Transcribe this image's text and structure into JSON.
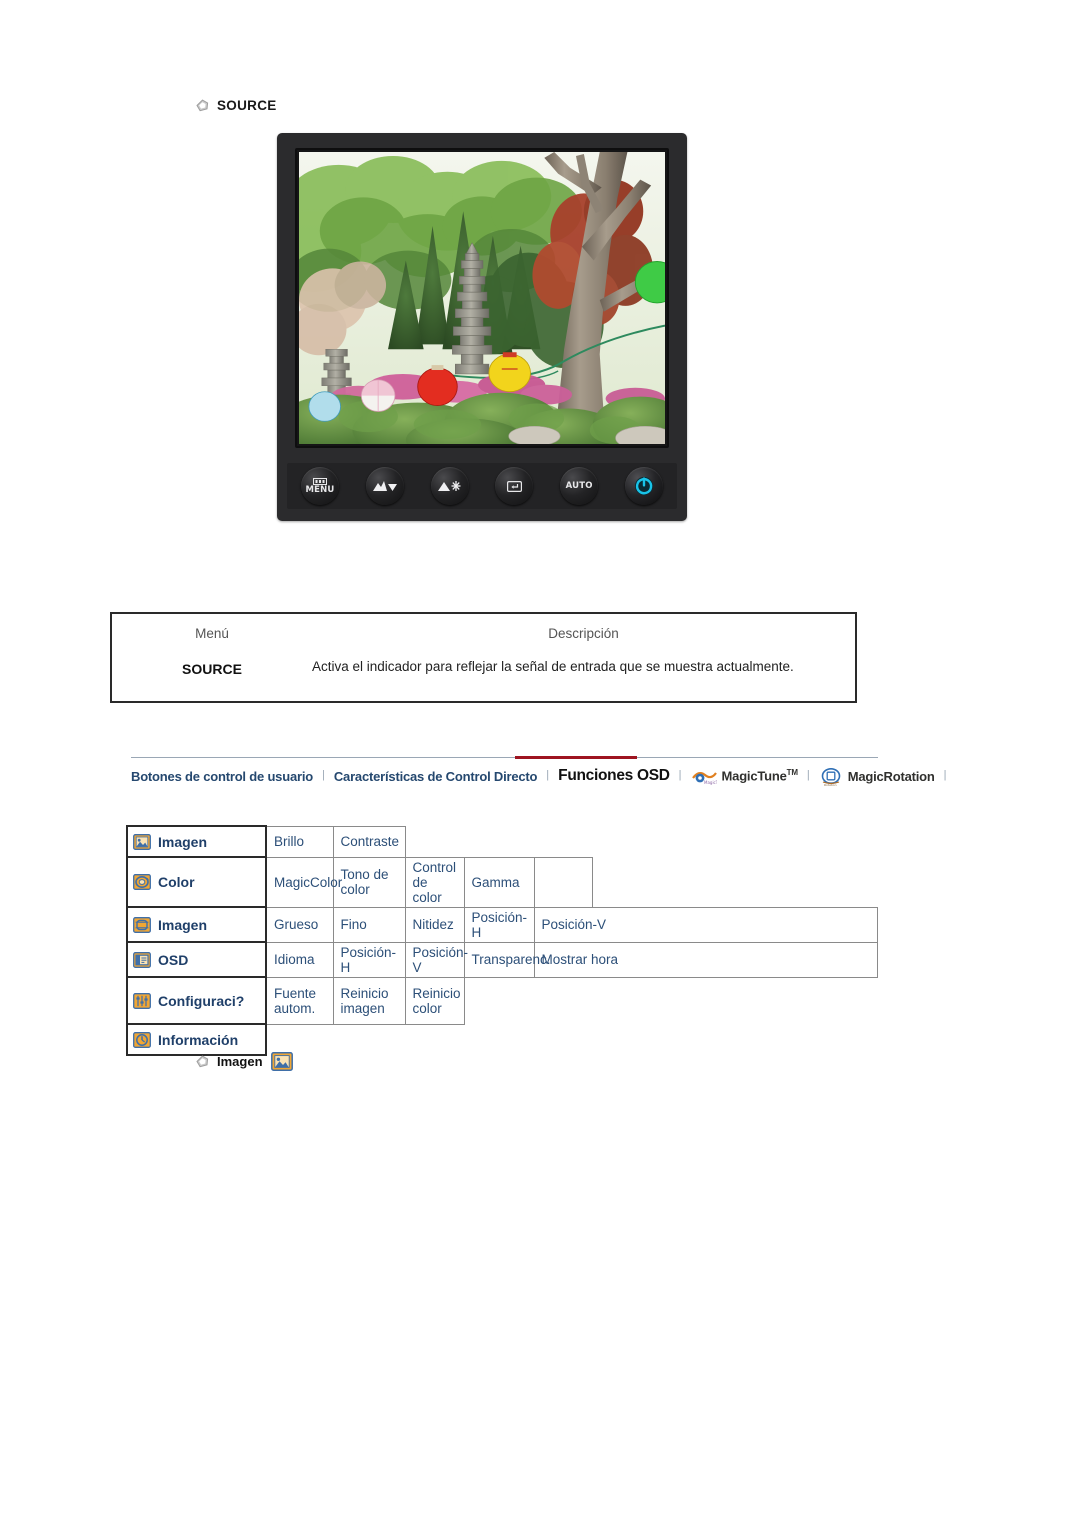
{
  "source_section": {
    "bullet_icon": "pentagon-bullet-icon",
    "heading": "SOURCE"
  },
  "monitor": {
    "screen_photo_alt": "korean-temple-garden-with-stone-pagoda-and-paper-lanterns",
    "buttons": [
      {
        "name": "menu-button",
        "icon": "menu-bars-icon",
        "label": "MENU"
      },
      {
        "name": "down-brightness-button",
        "icon": "brightness-down-arrow-icon",
        "label": ""
      },
      {
        "name": "up-brightness-button",
        "icon": "brightness-up-arrow-icon",
        "label": ""
      },
      {
        "name": "enter-button",
        "icon": "enter-rectangle-icon",
        "label": ""
      },
      {
        "name": "auto-button",
        "icon": "auto-text-icon",
        "label": "AUTO"
      },
      {
        "name": "power-button",
        "icon": "power-symbol-icon",
        "label": ""
      }
    ],
    "power_led_color": "#19c3e8"
  },
  "description_table": {
    "headers": {
      "menu": "Menú",
      "description": "Descripción"
    },
    "rows": [
      {
        "menu": "SOURCE",
        "description": "Activa el indicador para reflejar la señal de entrada que se muestra actualmente."
      }
    ]
  },
  "navbar": {
    "active_underline_color": "#9e1420",
    "separator": "|",
    "items": [
      {
        "label": "Botones de control de usuario",
        "active": false,
        "icon": null
      },
      {
        "label": "Características de Control Directo",
        "active": false,
        "icon": null
      },
      {
        "label": "Funciones OSD",
        "active": true,
        "icon": null
      },
      {
        "label": "MagicTune",
        "superscript": "TM",
        "active": false,
        "icon": "magictune-logo-icon"
      },
      {
        "label": "MagicRotation",
        "active": false,
        "icon": "magicrotation-logo-icon"
      }
    ]
  },
  "osd_table": {
    "rows": [
      {
        "icon": "picture-icon",
        "category": "Imagen",
        "items": [
          "Brillo",
          "Contraste"
        ]
      },
      {
        "icon": "color-palette-icon",
        "category": "Color",
        "items": [
          "MagicColor",
          "Tono de color",
          "Control de color",
          "Gamma"
        ]
      },
      {
        "icon": "image-geometry-icon",
        "category": "Imagen",
        "items": [
          "Grueso",
          "Fino",
          "Nitidez",
          "Posición-H",
          "Posición-V"
        ]
      },
      {
        "icon": "osd-window-icon",
        "category": "OSD",
        "items": [
          "Idioma",
          "Posición-H",
          "Posición-V",
          "Transparenc.",
          "Mostrar hora"
        ]
      },
      {
        "icon": "settings-sliders-icon",
        "category": "Configuraci?",
        "items": [
          "Fuente autom.",
          "Reinicio imagen",
          "Reinicio color"
        ]
      },
      {
        "icon": "information-icon",
        "category": "Información",
        "items": []
      }
    ]
  },
  "image_caption": {
    "bullet_icon": "pentagon-bullet-icon",
    "label": "Imagen",
    "icon": "picture-icon"
  }
}
